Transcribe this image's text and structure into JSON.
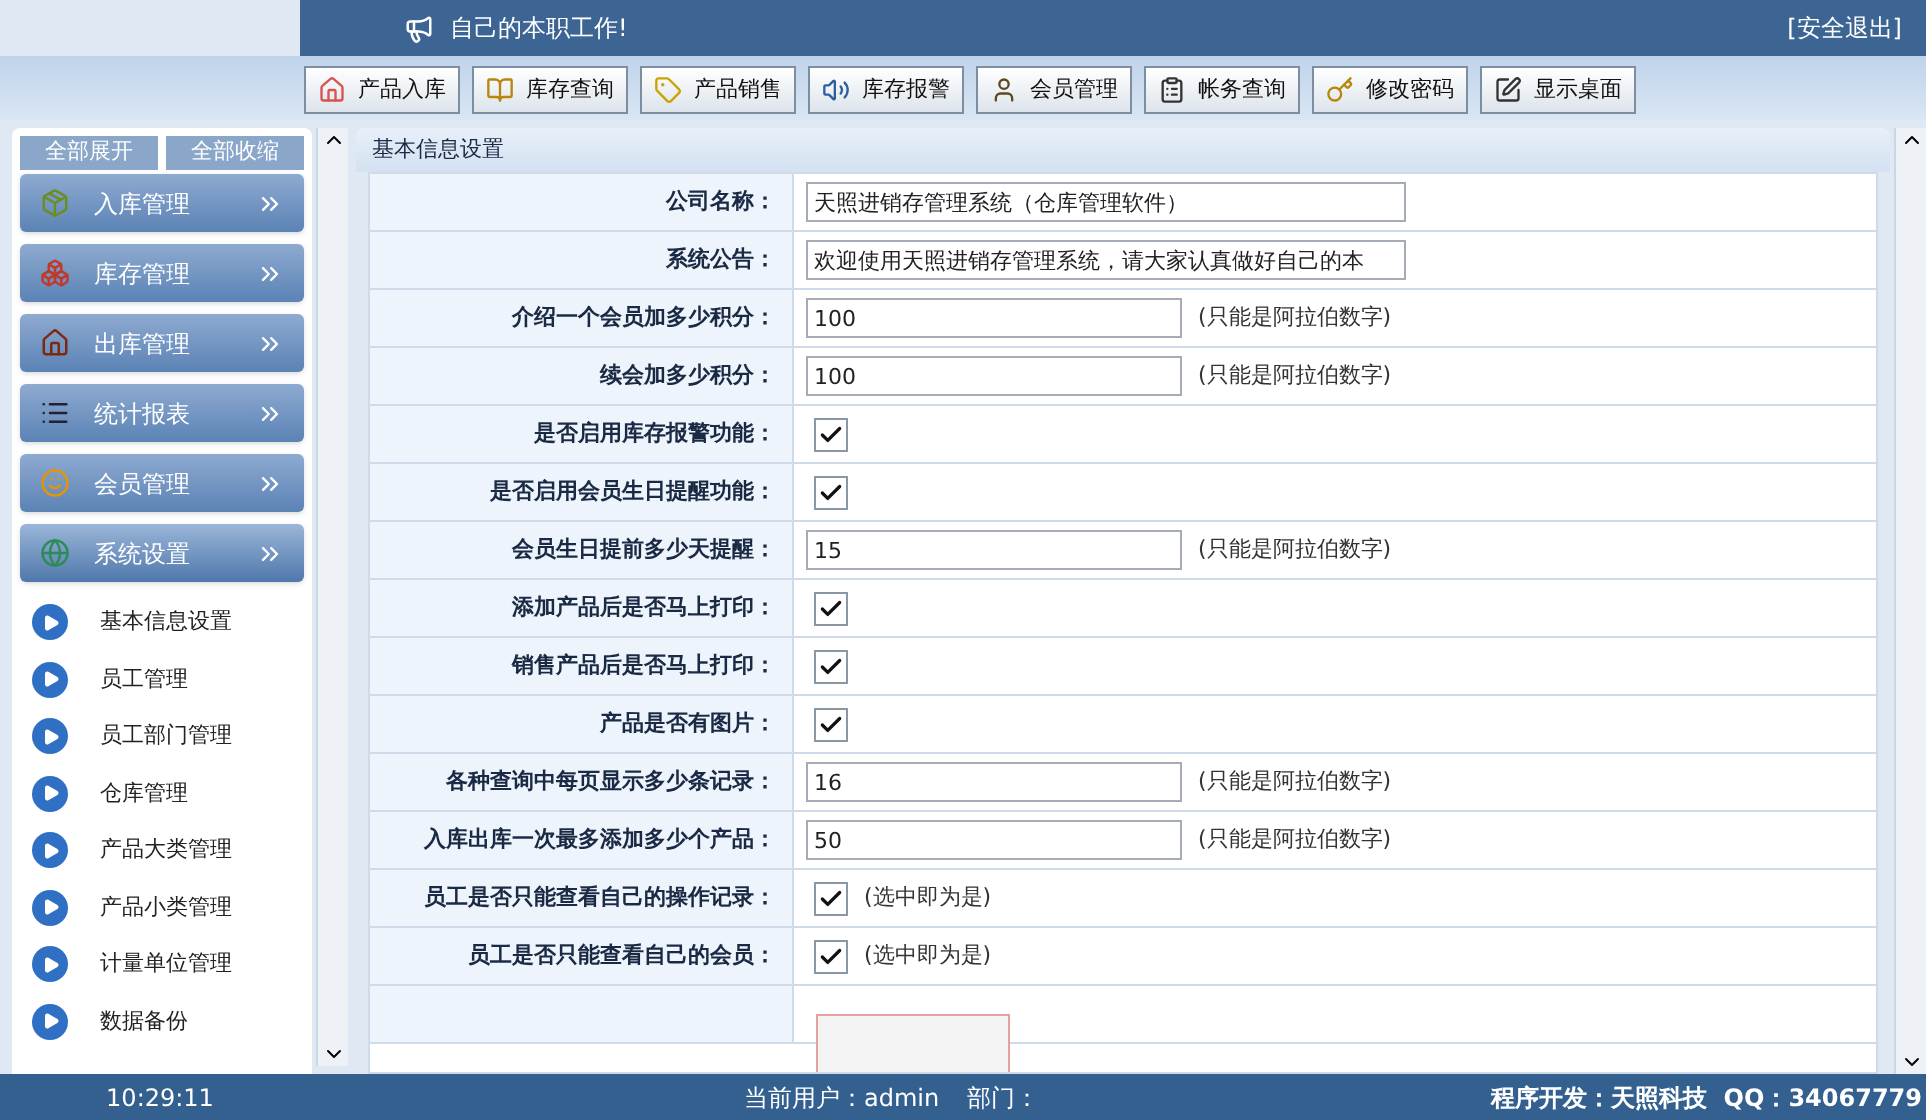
{
  "header": {
    "notice": "自己的本职工作!",
    "logout": "[安全退出]"
  },
  "toolbar": [
    {
      "label": "产品入库"
    },
    {
      "label": "库存查询"
    },
    {
      "label": "产品销售"
    },
    {
      "label": "库存报警"
    },
    {
      "label": "会员管理"
    },
    {
      "label": "帐务查询"
    },
    {
      "label": "修改密码"
    },
    {
      "label": "显示桌面"
    }
  ],
  "sidebar": {
    "expand_all": "全部展开",
    "collapse_all": "全部收缩",
    "groups": [
      {
        "label": "入库管理",
        "expanded": false
      },
      {
        "label": "库存管理",
        "expanded": false
      },
      {
        "label": "出库管理",
        "expanded": false
      },
      {
        "label": "统计报表",
        "expanded": false
      },
      {
        "label": "会员管理",
        "expanded": false
      },
      {
        "label": "系统设置",
        "expanded": true,
        "children": [
          "基本信息设置",
          "员工管理",
          "员工部门管理",
          "仓库管理",
          "产品大类管理",
          "产品小类管理",
          "计量单位管理",
          "数据备份"
        ]
      }
    ]
  },
  "panel": {
    "title": "基本信息设置",
    "rows": [
      {
        "kind": "long_text",
        "label": "公司名称：",
        "value": "天照进销存管理系统（仓库管理软件）"
      },
      {
        "kind": "long_text",
        "label": "系统公告：",
        "value": "欢迎使用天照进销存管理系统，请大家认真做好自己的本"
      },
      {
        "kind": "text",
        "label": "介绍一个会员加多少积分：",
        "value": "100",
        "hint": "(只能是阿拉伯数字)"
      },
      {
        "kind": "text",
        "label": "续会加多少积分：",
        "value": "100",
        "hint": "(只能是阿拉伯数字)"
      },
      {
        "kind": "checkbox",
        "label": "是否启用库存报警功能：",
        "checked": true
      },
      {
        "kind": "checkbox",
        "label": "是否启用会员生日提醒功能：",
        "checked": true
      },
      {
        "kind": "text",
        "label": "会员生日提前多少天提醒：",
        "value": "15",
        "hint": "(只能是阿拉伯数字)"
      },
      {
        "kind": "checkbox",
        "label": "添加产品后是否马上打印：",
        "checked": true
      },
      {
        "kind": "checkbox",
        "label": "销售产品后是否马上打印：",
        "checked": true
      },
      {
        "kind": "checkbox",
        "label": "产品是否有图片：",
        "checked": true
      },
      {
        "kind": "text",
        "label": "各种查询中每页显示多少条记录：",
        "value": "16",
        "hint": "(只能是阿拉伯数字)"
      },
      {
        "kind": "text",
        "label": "入库出库一次最多添加多少个产品：",
        "value": "50",
        "hint": "(只能是阿拉伯数字)"
      },
      {
        "kind": "checkbox",
        "label": "员工是否只能查看自己的操作记录：",
        "checked": true,
        "hint": "(选中即为是)"
      },
      {
        "kind": "checkbox",
        "label": "员工是否只能查看自己的会员：",
        "checked": true,
        "hint": "(选中即为是)"
      },
      {
        "kind": "image"
      }
    ]
  },
  "footer": {
    "time": "10:29:11",
    "user": "当前用户：admin",
    "dept": "部门：",
    "credit": "程序开发：天照科技  QQ：34067779"
  }
}
